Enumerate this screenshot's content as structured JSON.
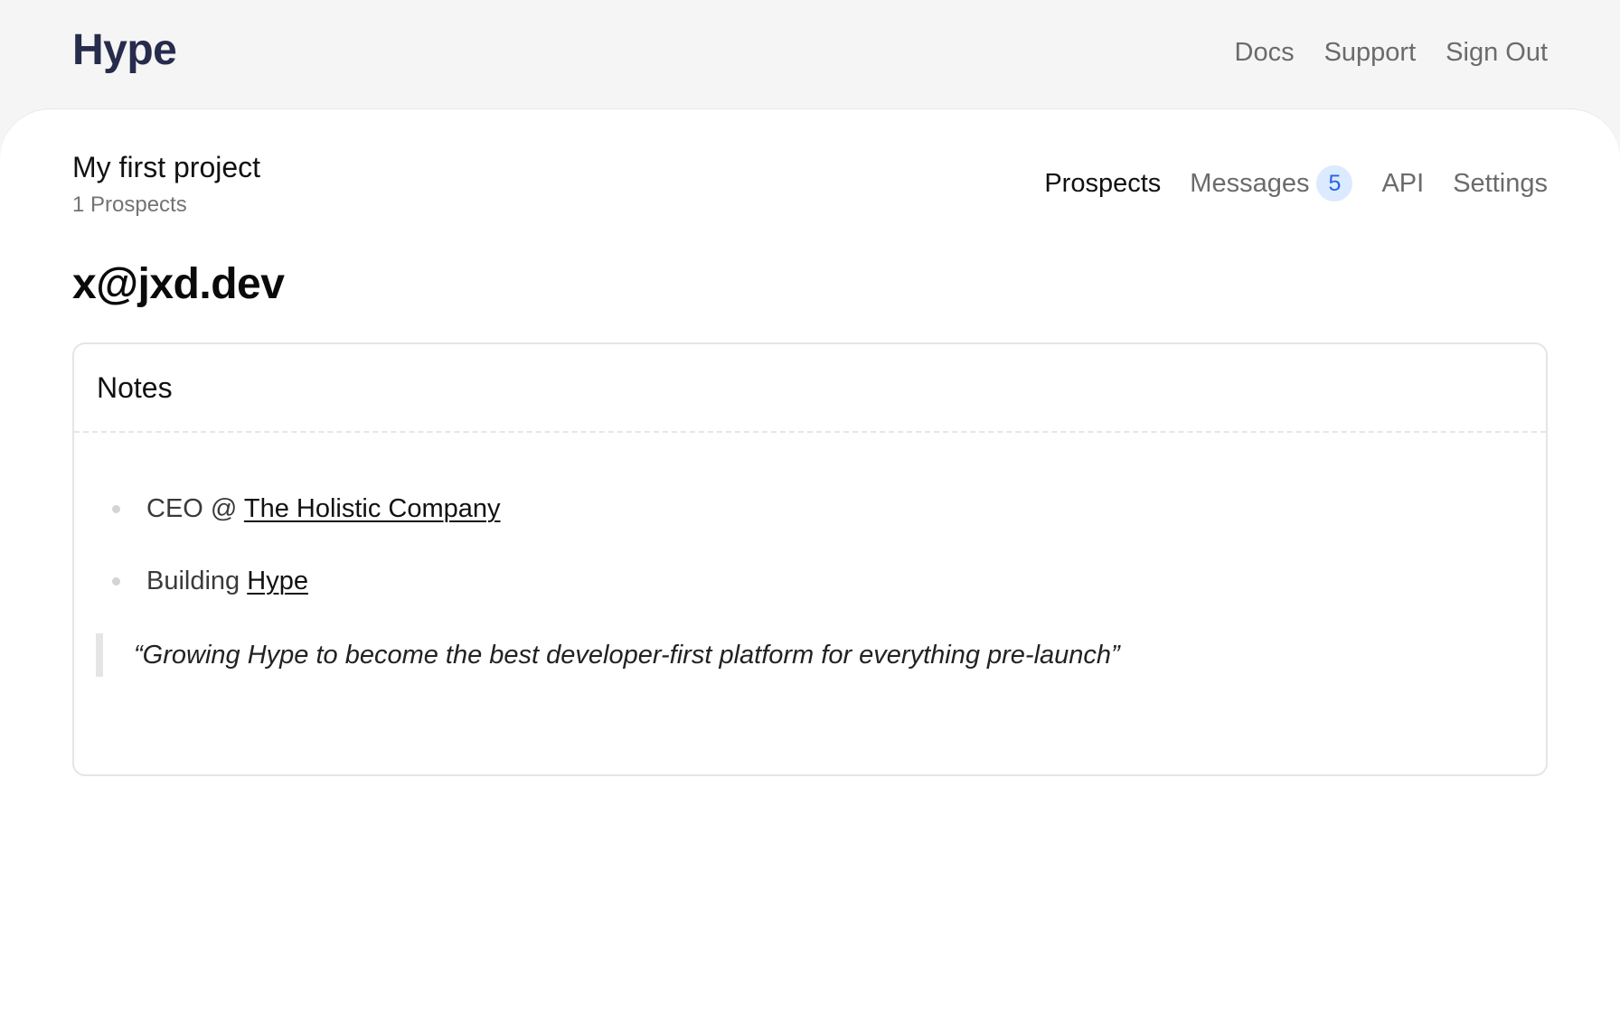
{
  "header": {
    "logo": "Hype",
    "nav": [
      {
        "label": "Docs"
      },
      {
        "label": "Support"
      },
      {
        "label": "Sign Out"
      }
    ]
  },
  "project": {
    "title": "My first project",
    "subtitle": "1 Prospects"
  },
  "tabs": {
    "prospects": "Prospects",
    "messages": "Messages",
    "messages_count": "5",
    "api": "API",
    "settings": "Settings",
    "active": "Prospects"
  },
  "prospect": {
    "email": "x@jxd.dev"
  },
  "notes": {
    "title": "Notes",
    "items": [
      {
        "prefix": "CEO @ ",
        "link": "The Holistic Company"
      },
      {
        "prefix": "Building ",
        "link": "Hype"
      }
    ],
    "quote": "“Growing Hype to become the best developer-first platform for everything pre-launch”"
  },
  "colors": {
    "background": "#f5f5f5",
    "surface": "#ffffff",
    "logo": "#272c4d",
    "badge_bg": "#dbeafe",
    "badge_text": "#2563eb"
  }
}
